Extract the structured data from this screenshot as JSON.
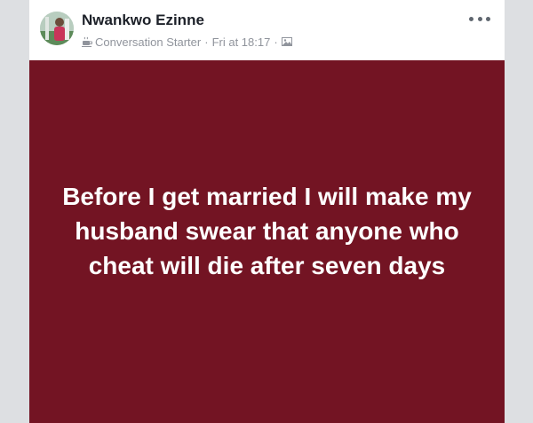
{
  "post": {
    "author_name": "Nwankwo Ezinne",
    "badge_icon": "coffee-cup-icon",
    "badge_label": "Conversation Starter",
    "separator": "·",
    "timestamp": "Fri at 18:17",
    "audience_icon": "public-image-icon",
    "menu_icon": "more-options-icon",
    "body_text": "Before I get married I will make my husband swear that anyone who cheat will die after seven days",
    "background_color": "#731423"
  },
  "colors": {
    "page_background": "#dddfe2",
    "author_name": "#1d2129",
    "meta_text": "#90949c",
    "post_text": "#ffffff"
  }
}
